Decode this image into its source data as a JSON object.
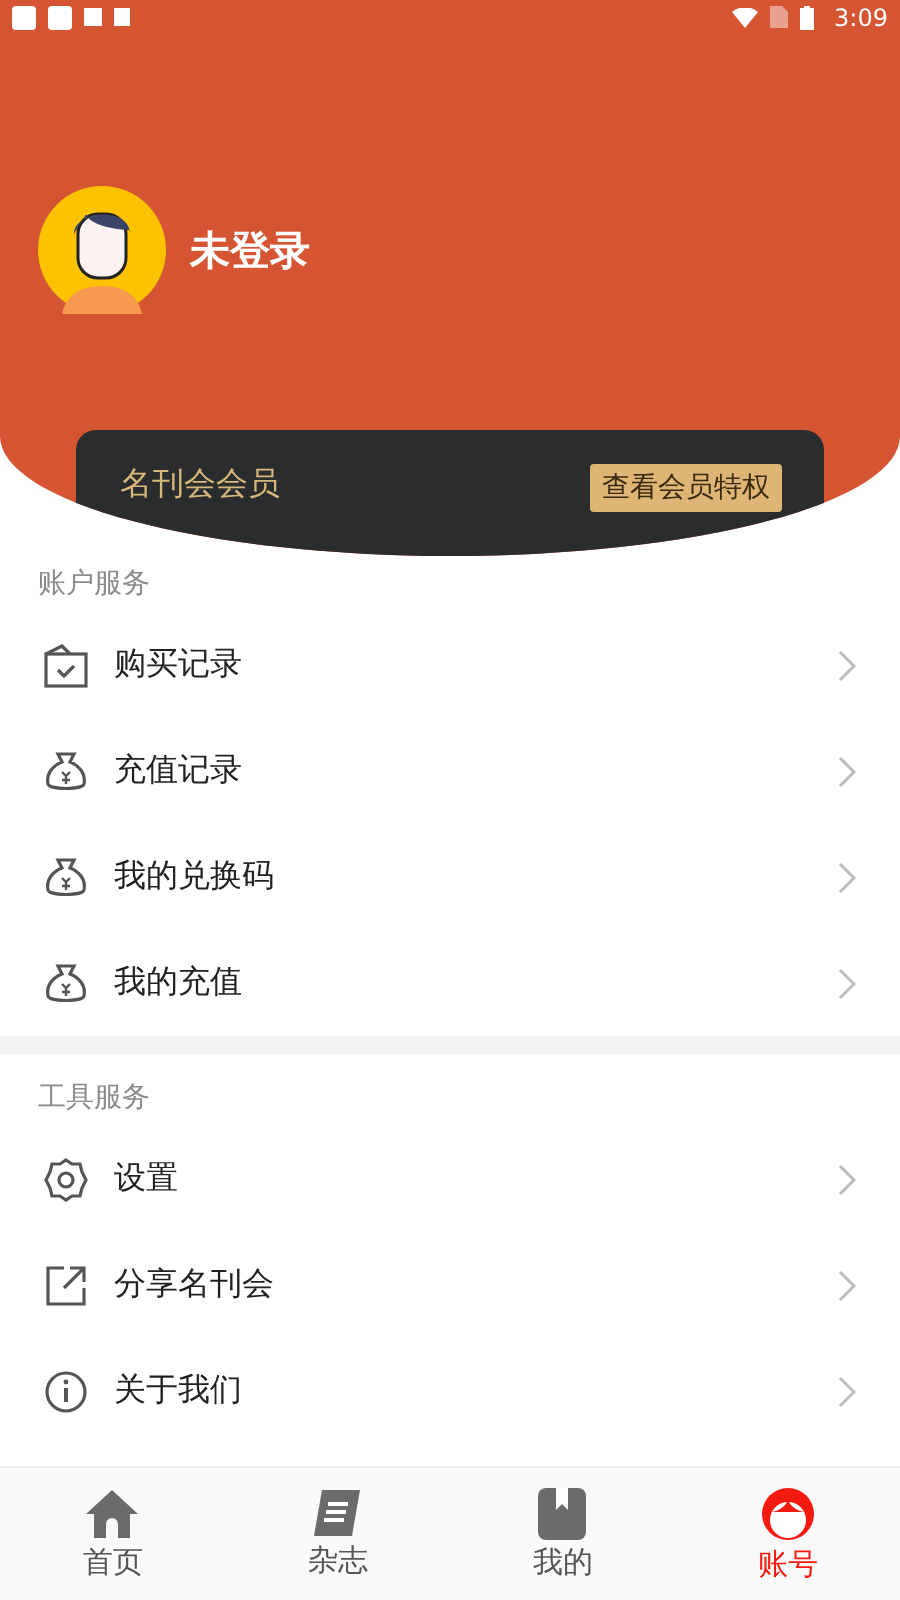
{
  "status_bar": {
    "time": "3:09"
  },
  "profile": {
    "name": "未登录"
  },
  "membership": {
    "title": "名刊会会员",
    "button": "查看会员特权"
  },
  "sections": [
    {
      "title": "账户服务",
      "items": [
        {
          "label": "购买记录",
          "kind": "box"
        },
        {
          "label": "充值记录",
          "kind": "bag"
        },
        {
          "label": "我的兑换码",
          "kind": "bag"
        },
        {
          "label": "我的充值",
          "kind": "bag"
        }
      ]
    },
    {
      "title": "工具服务",
      "items": [
        {
          "label": "设置",
          "kind": "gear"
        },
        {
          "label": "分享名刊会",
          "kind": "share"
        },
        {
          "label": "关于我们",
          "kind": "info"
        }
      ]
    }
  ],
  "tabs": [
    {
      "label": "首页",
      "kind": "home",
      "selected": false
    },
    {
      "label": "杂志",
      "kind": "mag",
      "selected": false
    },
    {
      "label": "我的",
      "kind": "book",
      "selected": false
    },
    {
      "label": "账号",
      "kind": "face",
      "selected": true
    }
  ]
}
